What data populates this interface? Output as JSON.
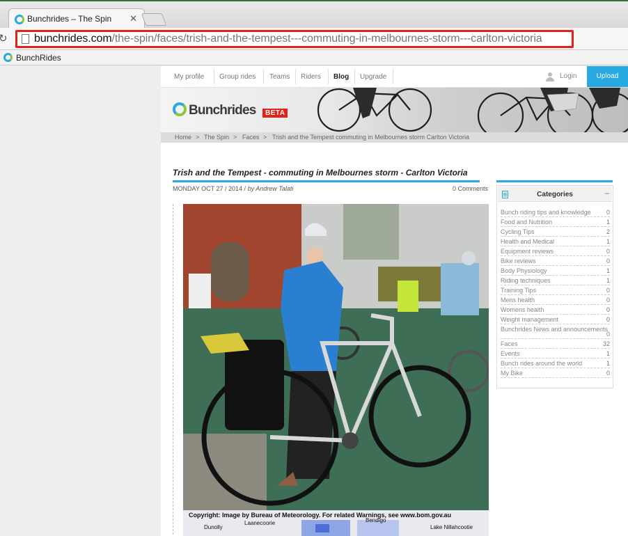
{
  "browser": {
    "tab_title": "Bunchrides – The Spin",
    "tab_close": "✕",
    "url_host": "bunchrides.com",
    "url_path": "/the-spin/faces/trish-and-the-tempest---commuting-in-melbournes-storm---carlton-victoria",
    "bookmark_label": "BunchRides",
    "highlight_color": "#e0231c"
  },
  "nav": {
    "items": [
      "My profile",
      "Group rides",
      "Teams",
      "Riders",
      "Blog",
      "Upgrade"
    ],
    "active": "Blog",
    "login": "Login",
    "upload": "Upload"
  },
  "brand": {
    "name": "Bunchrides",
    "badge": "BETA",
    "accent": "#29a9e1",
    "badge_color": "#e2231a"
  },
  "breadcrumb": [
    "Home",
    ">",
    "The Spin",
    ">",
    "Faces",
    ">",
    "Trish and the Tempest commuting in Melbournes storm Carlton Victoria"
  ],
  "post": {
    "title": "Trish and the Tempest - commuting in Melbournes storm - Carlton Victoria",
    "date": "MONDAY OCT 27 / 2014 /",
    "author": "by Andrew Talati",
    "comments": "0 Comments",
    "map_caption": "Copyright: Image by Bureau of Meteorology. For related Warnings, see www.bom.gov.au",
    "map_places": [
      "Dunolly",
      "Laanecoorie",
      "Bendigo",
      "Lake Nillahcootie"
    ]
  },
  "categories": {
    "title": "Categories",
    "collapse": "–",
    "items": [
      {
        "name": "Bunch riding tips and knowledge",
        "count": "0"
      },
      {
        "name": "Food and Nutrition",
        "count": "1"
      },
      {
        "name": "Cycling Tips",
        "count": "2"
      },
      {
        "name": "Health and Medical",
        "count": "1"
      },
      {
        "name": "Equipment reviews",
        "count": "0"
      },
      {
        "name": "Bike reviews",
        "count": "0"
      },
      {
        "name": "Body Physiology",
        "count": "1"
      },
      {
        "name": "Riding techniques",
        "count": "1"
      },
      {
        "name": "Training Tips",
        "count": "0"
      },
      {
        "name": "Mens health",
        "count": "0"
      },
      {
        "name": "Womens health",
        "count": "0"
      },
      {
        "name": "Weight management",
        "count": "0"
      },
      {
        "name": "Bunchrides News and announcements",
        "count": "0"
      },
      {
        "name": "Faces",
        "count": "32"
      },
      {
        "name": "Events",
        "count": "1"
      },
      {
        "name": "Bunch rides around the world",
        "count": "1"
      },
      {
        "name": "My Bike",
        "count": "0"
      }
    ]
  }
}
